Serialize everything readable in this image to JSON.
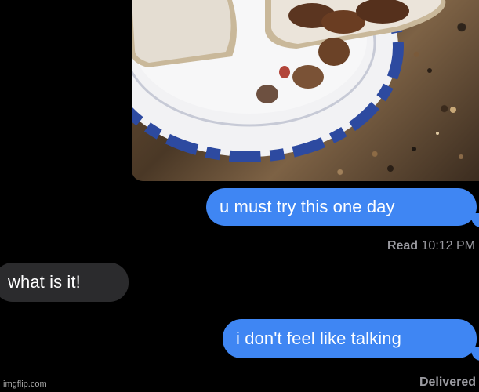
{
  "messages": [
    {
      "direction": "sent",
      "text": "u must try this one day"
    },
    {
      "direction": "received",
      "text": "what is it!"
    },
    {
      "direction": "sent",
      "text": "i don't feel like talking"
    }
  ],
  "read_receipt": {
    "label": "Read",
    "time": "10:12 PM"
  },
  "delivered_status": "Delivered",
  "attachment": {
    "icon": "photo-attachment-icon"
  },
  "watermark": "imgflip.com",
  "colors": {
    "background": "#000000",
    "sent_bubble": "#3f86f3",
    "received_bubble": "#2b2b2d",
    "status_text": "#9a9aa0"
  }
}
